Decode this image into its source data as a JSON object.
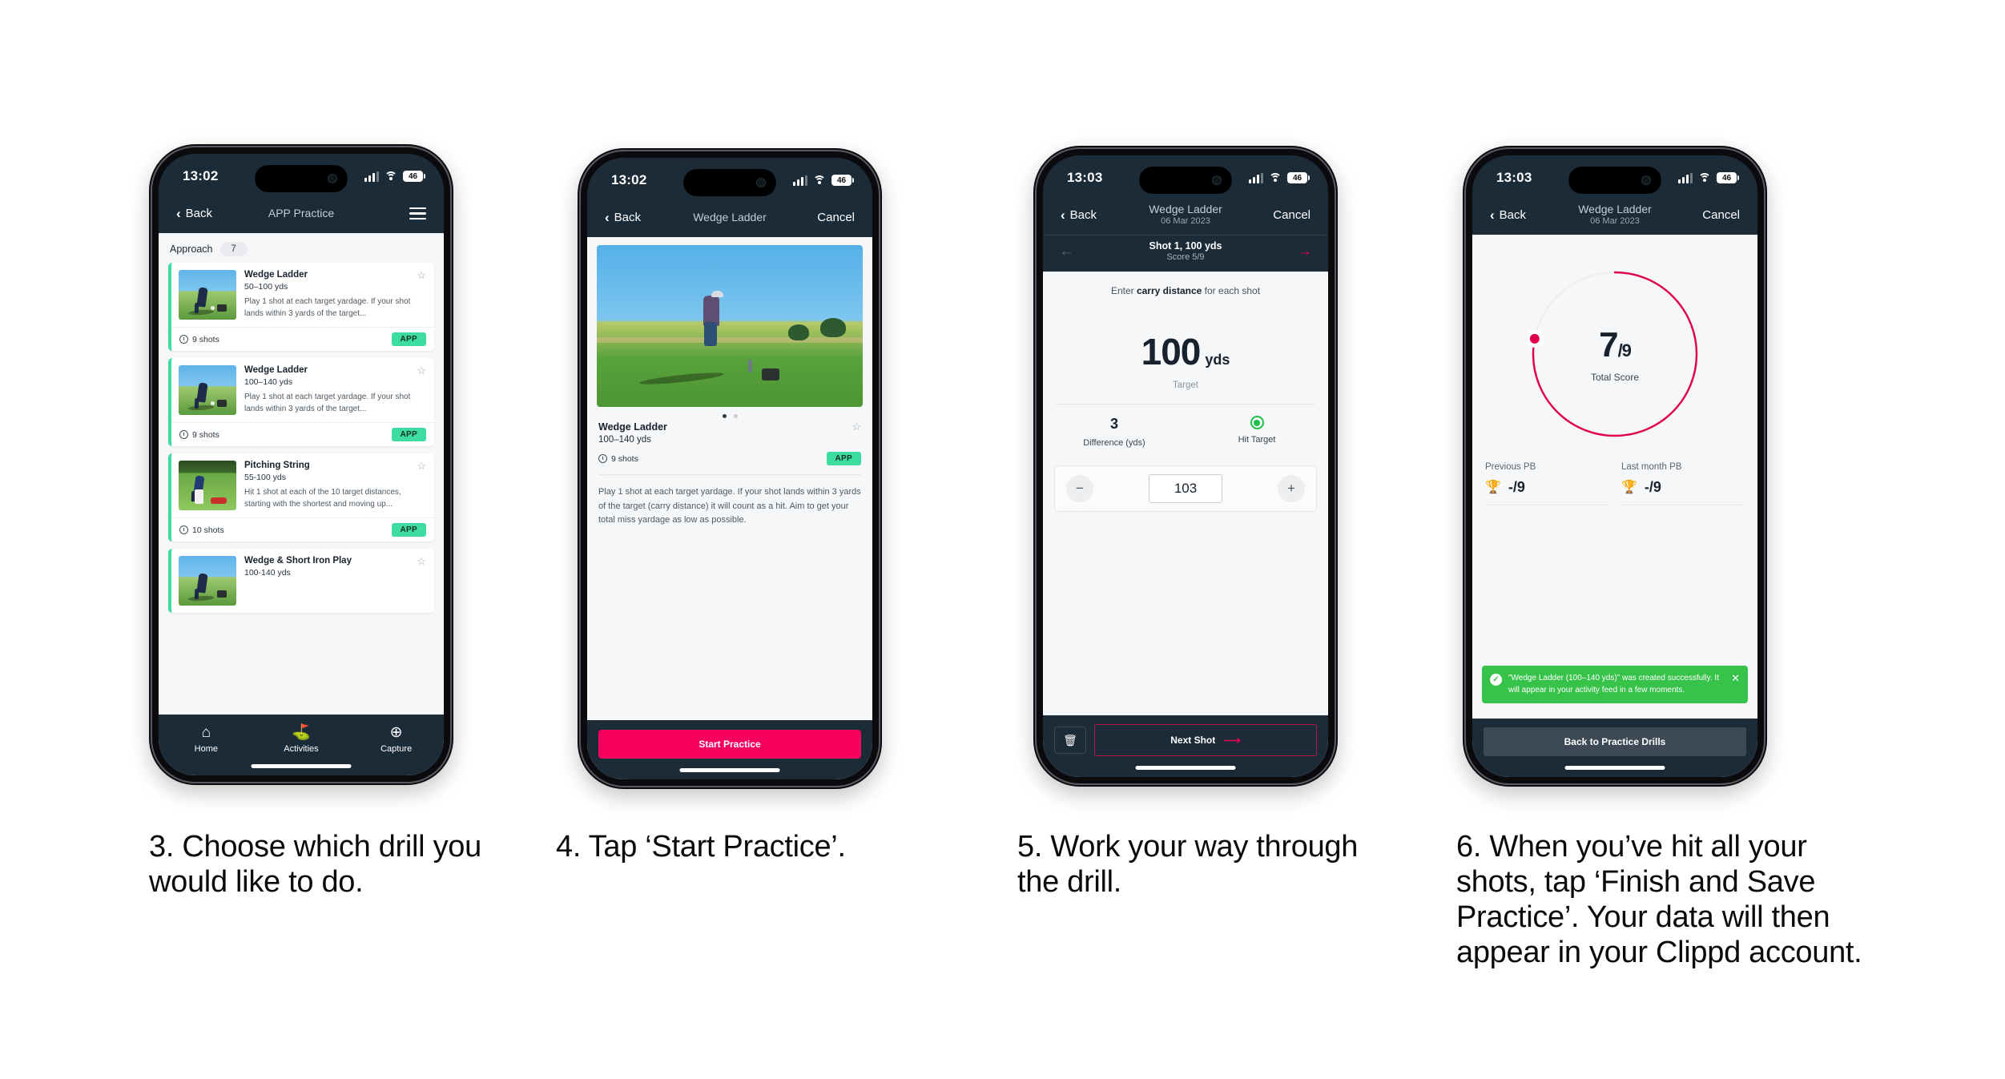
{
  "phones": [
    {
      "status": {
        "time": "13:02",
        "battery": "46"
      },
      "nav": {
        "back": "Back",
        "title": "APP Practice",
        "menu_icon": "hamburger-icon"
      },
      "section": {
        "label": "Approach",
        "count": "7"
      },
      "cards": [
        {
          "title": "Wedge Ladder",
          "yardage": "50–100 yds",
          "desc": "Play 1 shot at each target yardage. If your shot lands within 3 yards of the target...",
          "shots": "9 shots",
          "tag": "APP"
        },
        {
          "title": "Wedge Ladder",
          "yardage": "100–140 yds",
          "desc": "Play 1 shot at each target yardage. If your shot lands within 3 yards of the target...",
          "shots": "9 shots",
          "tag": "APP"
        },
        {
          "title": "Pitching String",
          "yardage": "55-100 yds",
          "desc": "Hit 1 shot at each of the 10 target distances, starting with the shortest and moving up...",
          "shots": "10 shots",
          "tag": "APP"
        },
        {
          "title": "Wedge & Short Iron Play",
          "yardage": "100-140 yds",
          "desc": "",
          "shots": "",
          "tag": ""
        }
      ],
      "tabs": [
        {
          "label": "Home",
          "icon": "home-icon"
        },
        {
          "label": "Activities",
          "icon": "golf-flag-icon"
        },
        {
          "label": "Capture",
          "icon": "plus-circle-icon"
        }
      ]
    },
    {
      "status": {
        "time": "13:02",
        "battery": "46"
      },
      "nav": {
        "back": "Back",
        "title": "Wedge Ladder",
        "cancel": "Cancel"
      },
      "detail": {
        "title": "Wedge Ladder",
        "yardage": "100–140 yds",
        "shots": "9 shots",
        "tag": "APP",
        "desc": "Play 1 shot at each target yardage. If your shot lands within 3 yards of the target (carry distance) it will count as a hit. Aim to get your total miss yardage as low as possible."
      },
      "cta": "Start Practice"
    },
    {
      "status": {
        "time": "13:03",
        "battery": "46"
      },
      "nav": {
        "back": "Back",
        "title": "Wedge Ladder",
        "subtitle": "06 Mar 2023",
        "cancel": "Cancel"
      },
      "shotbar": {
        "title": "Shot 1, 100 yds",
        "score": "Score 5/9"
      },
      "prompt_pre": "Enter ",
      "prompt_bold": "carry distance",
      "prompt_post": " for each shot",
      "target": {
        "value": "100",
        "unit": "yds",
        "caption": "Target"
      },
      "stats": [
        {
          "value": "3",
          "label": "Difference (yds)"
        },
        {
          "value": "",
          "label": "Hit Target"
        }
      ],
      "stepper": {
        "minus": "−",
        "value": "103",
        "plus": "+"
      },
      "footer": {
        "delete_icon": "trash-icon",
        "next": "Next Shot"
      }
    },
    {
      "status": {
        "time": "13:03",
        "battery": "46"
      },
      "nav": {
        "back": "Back",
        "title": "Wedge Ladder",
        "subtitle": "06 Mar 2023",
        "cancel": "Cancel"
      },
      "ring": {
        "score": "7",
        "denominator": "/9",
        "caption": "Total Score",
        "percent": 78,
        "color": "#e0004d"
      },
      "pbs": [
        {
          "label": "Previous PB",
          "value": "-/9"
        },
        {
          "label": "Last month PB",
          "value": "-/9"
        }
      ],
      "toast": {
        "message": "\"Wedge Ladder (100–140 yds)\" was created successfully. It will appear in your activity feed in a few moments.",
        "close_icon": "close-icon"
      },
      "footer_button": "Back to Practice Drills"
    }
  ],
  "captions": [
    "3. Choose which drill you would like to do.",
    "4. Tap ‘Start Practice’.",
    "5. Work your way through the drill.",
    "6. When you’ve hit all your shots, tap ‘Finish and Save Practice’. Your data will then appear in your Clippd account."
  ],
  "colors": {
    "dark": "#1c2b38",
    "accent_pink": "#f5005e",
    "accent_green": "#3ddca0",
    "toast_green": "#37c24a"
  }
}
